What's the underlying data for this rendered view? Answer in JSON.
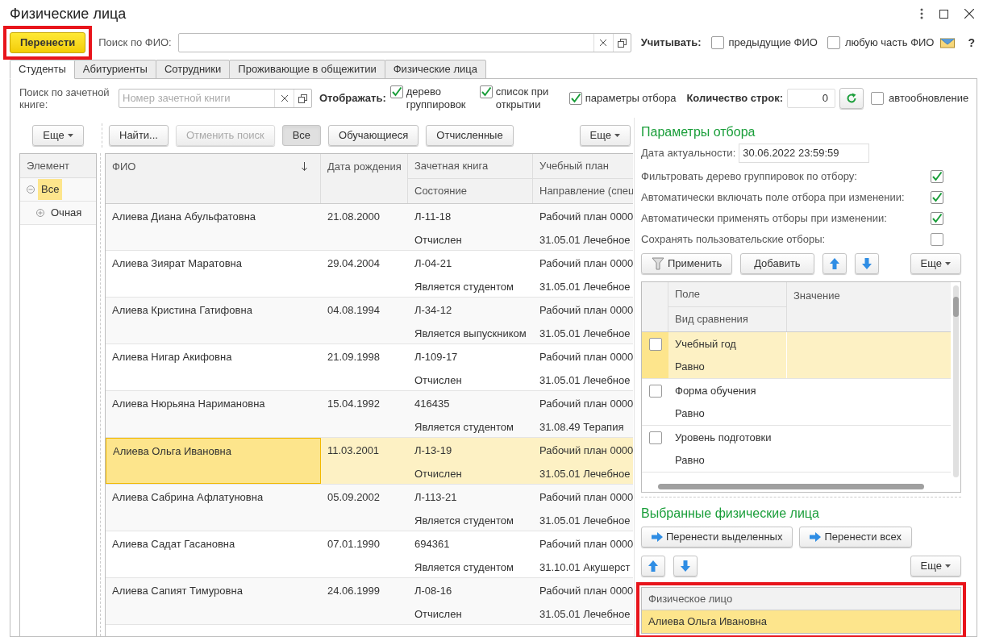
{
  "window": {
    "title": "Физические лица"
  },
  "toolbar": {
    "transfer_button": "Перенести",
    "search_label": "Поиск по ФИО:",
    "consider_label": "Учитывать:",
    "consider_options": [
      {
        "label": "предыдущие ФИО",
        "checked": false
      },
      {
        "label": "любую часть ФИО",
        "checked": false
      }
    ],
    "help": "?"
  },
  "tabs": [
    {
      "label": "Студенты",
      "selected": true
    },
    {
      "label": "Абитуриенты",
      "selected": false
    },
    {
      "label": "Сотрудники",
      "selected": false
    },
    {
      "label": "Проживающие в общежитии",
      "selected": false
    },
    {
      "label": "Физические лица",
      "selected": false
    }
  ],
  "record_search": {
    "label": "Поиск по зачетной книге:",
    "placeholder": "Номер зачетной книги"
  },
  "display": {
    "label": "Отображать:",
    "options": [
      {
        "label": "дерево группировок",
        "checked": true
      },
      {
        "label": "список при открытии",
        "checked": true
      },
      {
        "label": "параметры отбора",
        "checked": true
      }
    ]
  },
  "rows_count": {
    "label": "Количество строк:",
    "value": "0"
  },
  "autoupdate": {
    "label": "автообновление",
    "checked": false
  },
  "list_toolbar": {
    "more": "Еще",
    "buttons": [
      {
        "label": "Найти...",
        "disabled": false,
        "pressed": false
      },
      {
        "label": "Отменить поиск",
        "disabled": true,
        "pressed": false
      },
      {
        "label": "Все",
        "disabled": false,
        "pressed": true
      },
      {
        "label": "Обучающиеся",
        "disabled": false,
        "pressed": false
      },
      {
        "label": "Отчисленные",
        "disabled": false,
        "pressed": false
      }
    ],
    "more_right": "Еще"
  },
  "tree": {
    "header": "Элемент",
    "items": [
      {
        "label": "Все",
        "expanded": true,
        "selected": true,
        "children": [
          {
            "label": "Очная",
            "expanded": false,
            "selected": false
          }
        ]
      }
    ]
  },
  "table": {
    "columns": [
      {
        "label": "ФИО",
        "sorted": true
      },
      {
        "label": "Дата рождения"
      },
      {
        "label": "Зачетная книга",
        "sub": "Состояние"
      },
      {
        "label": "Учебный план",
        "sub": "Направление (спец"
      }
    ],
    "rows": [
      {
        "name": "Алиева Диана Абульфатовна",
        "birth": "21.08.2000",
        "record": "Л-11-18",
        "status": "Отчислен",
        "plan": "Рабочий план 0000",
        "direction": "31.05.01 Лечебное",
        "selected": false
      },
      {
        "name": "Алиева Зиярат Маратовна",
        "birth": "29.04.2004",
        "record": "Л-04-21",
        "status": "Является студентом",
        "plan": "Рабочий план 0000",
        "direction": "31.05.01 Лечебное",
        "selected": false
      },
      {
        "name": "Алиева Кристина Гатифовна",
        "birth": "04.08.1994",
        "record": "Л-34-12",
        "status": "Является выпускником",
        "plan": "Рабочий план 0000",
        "direction": "31.05.01 Лечебное",
        "selected": false
      },
      {
        "name": "Алиева Нигар Акифовна",
        "birth": "21.09.1998",
        "record": "Л-109-17",
        "status": "Отчислен",
        "plan": "Рабочий план 0000",
        "direction": "31.05.01 Лечебное",
        "selected": false
      },
      {
        "name": "Алиева Нюрьяна Наримановна",
        "birth": "15.04.1992",
        "record": "416435",
        "status": "Является студентом",
        "plan": "Рабочий план 0000",
        "direction": "31.08.49 Терапия",
        "selected": false
      },
      {
        "name": "Алиева Ольга Ивановна",
        "birth": "11.03.2001",
        "record": "Л-13-19",
        "status": "Отчислен",
        "plan": "Рабочий план 0000",
        "direction": "31.05.01 Лечебное",
        "selected": true
      },
      {
        "name": "Алиева Сабрина Афлатуновна",
        "birth": "05.09.2002",
        "record": "Л-113-21",
        "status": "Является студентом",
        "plan": "Рабочий план 0000",
        "direction": "31.05.01 Лечебное",
        "selected": false
      },
      {
        "name": "Алиева Садат Гасановна",
        "birth": "07.01.1990",
        "record": "694361",
        "status": "Является студентом",
        "plan": "Рабочий план 0000",
        "direction": "31.10.01 Акушерст",
        "selected": false
      },
      {
        "name": "Алиева Сапият Тимуровна",
        "birth": "24.06.1999",
        "record": "Л-08-16",
        "status": "Отчислен",
        "plan": "Рабочий план 0000",
        "direction": "31.05.01 Лечебное",
        "selected": false
      }
    ]
  },
  "filter_params": {
    "title": "Параметры отбора",
    "date_label": "Дата актуальности:",
    "date_value": "30.06.2022 23:59:59",
    "options": [
      {
        "label": "Фильтровать дерево группировок по отбору:",
        "checked": true
      },
      {
        "label": "Автоматически включать поле отбора при изменении:",
        "checked": true
      },
      {
        "label": "Автоматически применять отборы при изменении:",
        "checked": true
      },
      {
        "label": "Сохранять пользовательские отборы:",
        "checked": false
      }
    ],
    "apply": "Применить",
    "add": "Добавить",
    "more": "Еще",
    "columns": {
      "field": "Поле",
      "comparison": "Вид сравнения",
      "value": "Значение"
    },
    "rows": [
      {
        "field": "Учебный год",
        "comparison": "Равно",
        "checked": false,
        "selected": true
      },
      {
        "field": "Форма обучения",
        "comparison": "Равно",
        "checked": false,
        "selected": false
      },
      {
        "field": "Уровень подготовки",
        "comparison": "Равно",
        "checked": false,
        "selected": false
      }
    ]
  },
  "selected_persons": {
    "title": "Выбранные физические лица",
    "transfer_selected": "Перенести выделенных",
    "transfer_all": "Перенести всех",
    "more": "Еще",
    "header": "Физическое лицо",
    "rows": [
      {
        "name": "Алиева Ольга Ивановна",
        "selected": true
      }
    ]
  }
}
